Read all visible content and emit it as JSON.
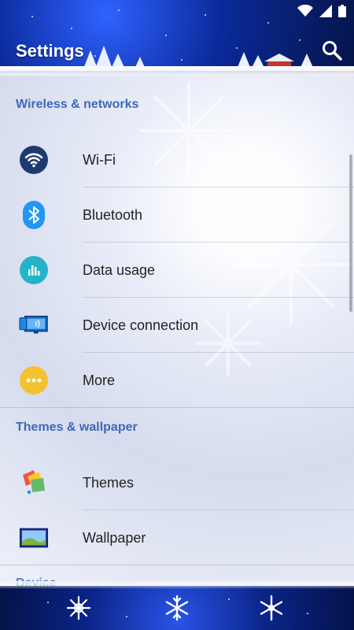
{
  "header": {
    "title": "Settings"
  },
  "sections": [
    {
      "title": "Wireless & networks",
      "items": [
        {
          "label": "Wi-Fi",
          "icon": "wifi-icon"
        },
        {
          "label": "Bluetooth",
          "icon": "bluetooth-icon"
        },
        {
          "label": "Data usage",
          "icon": "data-usage-icon"
        },
        {
          "label": "Device connection",
          "icon": "device-connection-icon"
        },
        {
          "label": "More",
          "icon": "more-icon"
        }
      ]
    },
    {
      "title": "Themes & wallpaper",
      "items": [
        {
          "label": "Themes",
          "icon": "themes-icon"
        },
        {
          "label": "Wallpaper",
          "icon": "wallpaper-icon"
        }
      ]
    }
  ],
  "partial_section_title": "Device",
  "nav": {
    "buttons": [
      {
        "icon": "back-snowflake-icon"
      },
      {
        "icon": "home-snowflake-icon"
      },
      {
        "icon": "recents-snowflake-icon"
      }
    ]
  },
  "colors": {
    "section_title": "#3d69b8",
    "header_bg": "#0b2a9b",
    "wifi_icon_bg": "#1e3a6e",
    "bluetooth_icon_bg": "#2196f3",
    "data_usage_icon_bg": "#26b3c9",
    "more_icon_bg": "#f2c230"
  }
}
